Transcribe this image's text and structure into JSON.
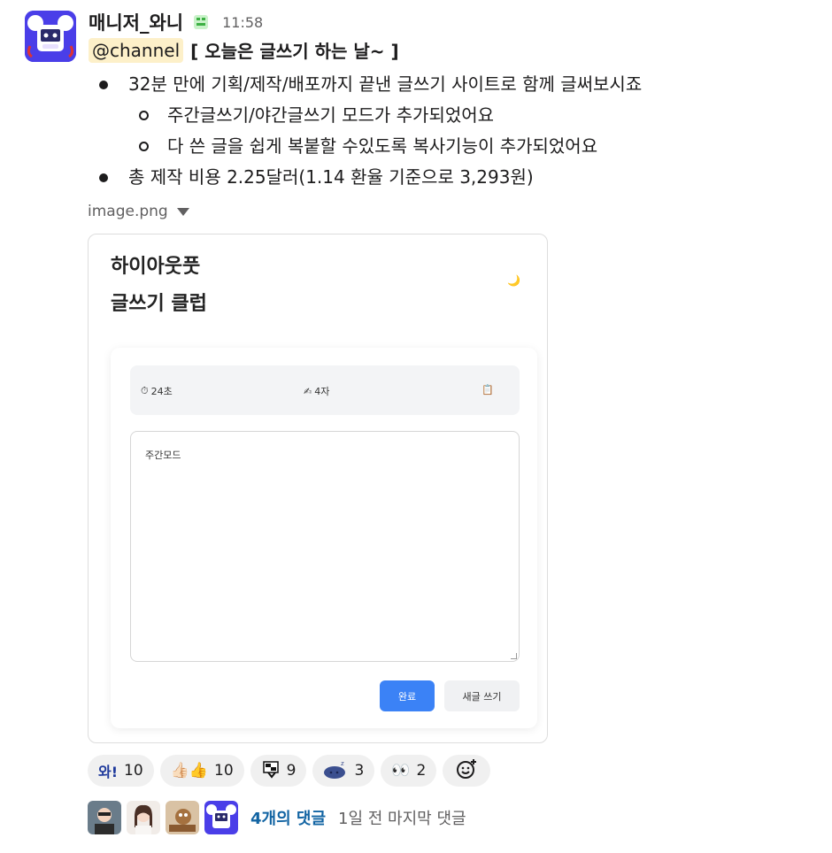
{
  "message": {
    "username": "매니저_와니",
    "timestamp": "11:58",
    "mention": "@channel",
    "headline": "[ 오늘은 글쓰기 하는 날~ ]",
    "bullets": [
      "32분 만에 기획/제작/배포까지 끝낸 글쓰기 사이트로 함께 글써보시죠",
      "주간글쓰기/야간글쓰기 모드가 추가되었어요",
      "다 쓴 글을 쉽게 복붙할 수있도록 복사기능이 추가되었어요",
      "총 제작 비용 2.25달러(1.14 환율 기준으로 3,293원)"
    ]
  },
  "attachment": {
    "filename": "image.png",
    "app": {
      "title_line1": "하이아웃풋",
      "title_line2": "글쓰기 클럽",
      "theme_icon": "🌙",
      "timer_icon": "⏱",
      "timer": "24초",
      "chars_icon": "✍",
      "chars": "4자",
      "copy_icon": "📋",
      "placeholder": "주간모드",
      "done_button": "완료",
      "new_button": "새글 쓰기",
      "accent_color": "#3b82f6"
    }
  },
  "reactions": [
    {
      "emoji": "와!",
      "count": "10"
    },
    {
      "emoji": "👍🏻👍",
      "count": "10"
    },
    {
      "emoji": "flag-emoji",
      "count": "9"
    },
    {
      "emoji": "sleeping-blob-emoji",
      "count": "3"
    },
    {
      "emoji": "👀",
      "count": "2"
    }
  ],
  "thread": {
    "reply_count": "4개의 댓글",
    "last_reply": "1일 전 마지막 댓글"
  }
}
